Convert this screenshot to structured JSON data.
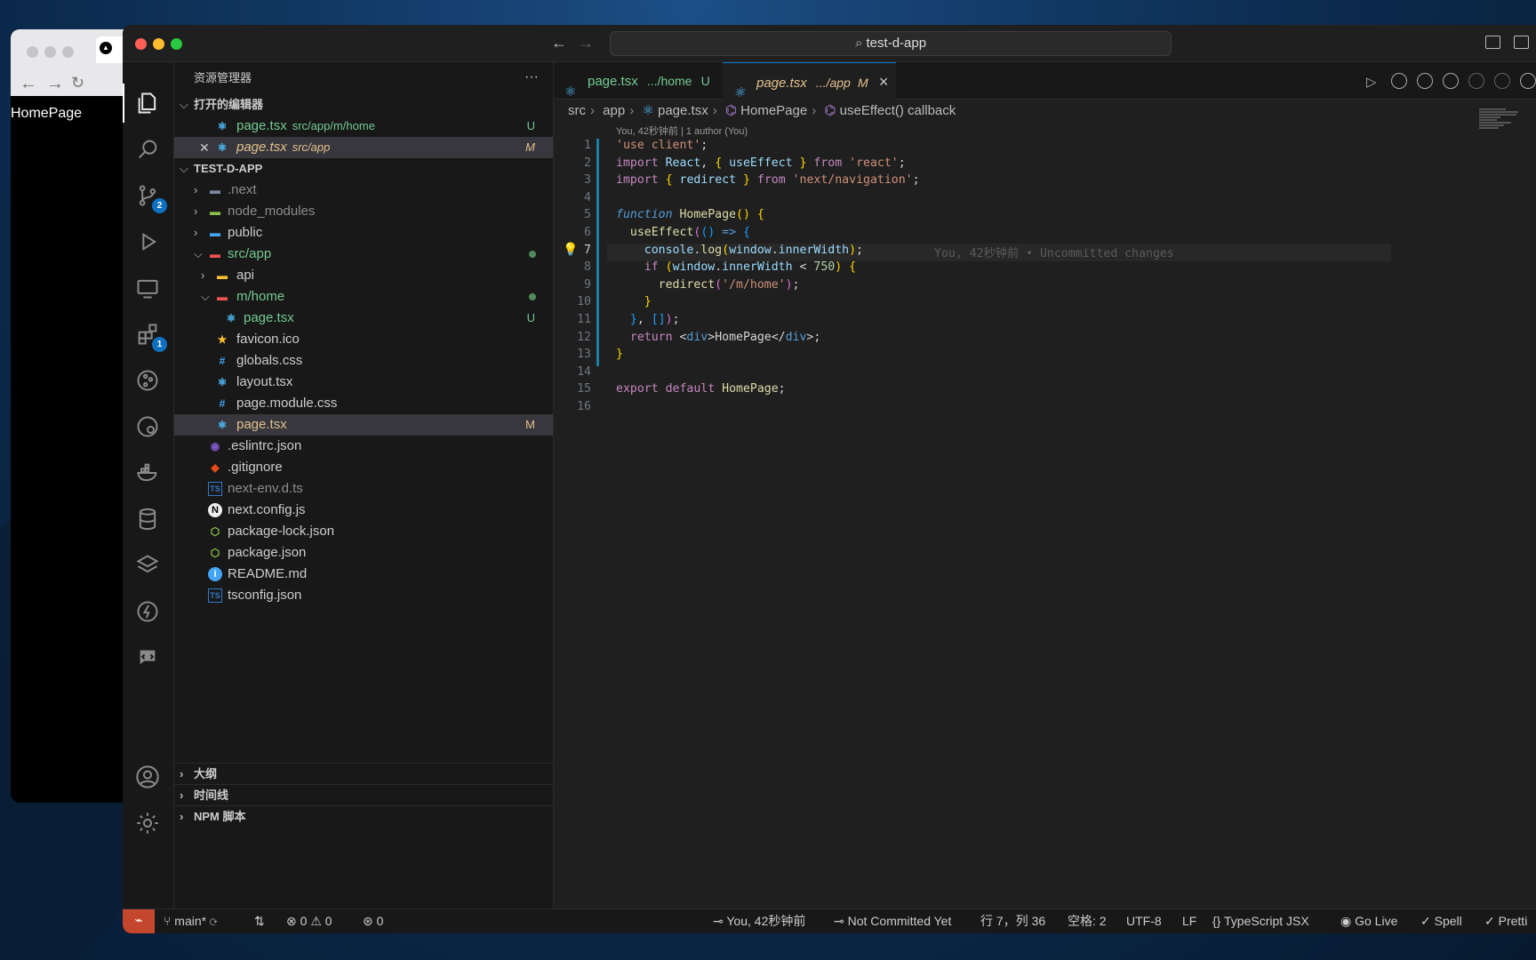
{
  "browser": {
    "page_text": "HomePage"
  },
  "titlebar": {
    "search": "test-d-app"
  },
  "sidebar": {
    "title": "资源管理器",
    "more": "···",
    "open_editors_title": "打开的编辑器",
    "open_editors": [
      {
        "name": "page.tsx",
        "path": "src/app/m/home",
        "status": "U"
      },
      {
        "name": "page.tsx",
        "path": "src/app",
        "status": "M"
      }
    ],
    "project_title": "TEST-D-APP",
    "tree": [
      {
        "name": ".next"
      },
      {
        "name": "node_modules"
      },
      {
        "name": "public"
      },
      {
        "name": "src/app"
      },
      {
        "name": "api"
      },
      {
        "name": "m/home"
      },
      {
        "name": "page.tsx",
        "status": "U"
      },
      {
        "name": "favicon.ico"
      },
      {
        "name": "globals.css"
      },
      {
        "name": "layout.tsx"
      },
      {
        "name": "page.module.css"
      },
      {
        "name": "page.tsx",
        "status": "M"
      },
      {
        "name": ".eslintrc.json"
      },
      {
        "name": ".gitignore"
      },
      {
        "name": "next-env.d.ts"
      },
      {
        "name": "next.config.js"
      },
      {
        "name": "package-lock.json"
      },
      {
        "name": "package.json"
      },
      {
        "name": "README.md"
      },
      {
        "name": "tsconfig.json"
      }
    ],
    "outline": "大纲",
    "timeline": "时间线",
    "npm": "NPM 脚本"
  },
  "activity": {
    "scm_badge": "2",
    "ext_badge": "1"
  },
  "tabs": [
    {
      "name": "page.tsx",
      "path": ".../home",
      "status": "U"
    },
    {
      "name": "page.tsx",
      "path": ".../app",
      "status": "M",
      "close": "×"
    }
  ],
  "breadcrumb": [
    "src",
    "app",
    "page.tsx",
    "HomePage",
    "useEffect() callback"
  ],
  "codelens": "You, 42秒钟前 | 1 author (You)",
  "code": {
    "line_numbers": [
      "1",
      "2",
      "3",
      "4",
      "5",
      "6",
      "7",
      "8",
      "9",
      "10",
      "11",
      "12",
      "13",
      "14",
      "15",
      "16"
    ],
    "inline_blame": "You, 42秒钟前 • Uncommitted changes"
  },
  "status": {
    "remote": "⌁",
    "branch": "main*",
    "sync": "⟳",
    "errors": "0",
    "warnings": "0",
    "ports": "0",
    "blame": "You, 42秒钟前",
    "commit": "Not Committed Yet",
    "position": "行 7，列 36",
    "spaces": "空格: 2",
    "encoding": "UTF-8",
    "eol": "LF",
    "language": "TypeScript JSX",
    "golive": "Go Live",
    "spell": "Spell",
    "prettier": "Pretti"
  },
  "colors": {
    "accent": "#0078d4",
    "modified": "#e2c08d",
    "untracked": "#73c991",
    "remote": "#c4462c"
  }
}
